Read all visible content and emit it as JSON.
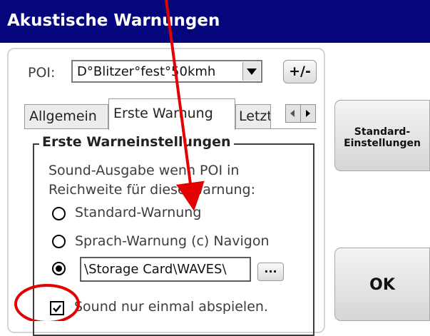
{
  "window": {
    "title": "Akustische Warnungen"
  },
  "poi": {
    "label": "POI:",
    "selected": "D°Blitzer°fest°50kmh",
    "plusminus_label": "+/-"
  },
  "tabs": [
    {
      "label": "Allgemein"
    },
    {
      "label": "Erste Warnung",
      "active": true
    },
    {
      "label": "Letzte"
    }
  ],
  "group": {
    "title": "Erste Warneinstellungen",
    "description_line1": "Sound-Ausgabe wenn POI in",
    "description_line2": "Reichweite für diese Warnung:",
    "options": [
      {
        "label": "Standard-Warnung",
        "selected": false
      },
      {
        "label": "Sprach-Warnung (c) Navigon",
        "selected": false
      },
      {
        "label": "",
        "selected": true
      }
    ],
    "custom_path": "\\Storage Card\\WAVES\\",
    "browse_label": "...",
    "play_once_label": "Sound nur einmal abspielen.",
    "play_once_checked": true
  },
  "side_buttons": {
    "standard_line1": "Standard-",
    "standard_line2": "Einstellungen",
    "ok": "OK"
  },
  "annotation_color": "#e30000",
  "theme": {
    "titlebar": "#06067c"
  }
}
